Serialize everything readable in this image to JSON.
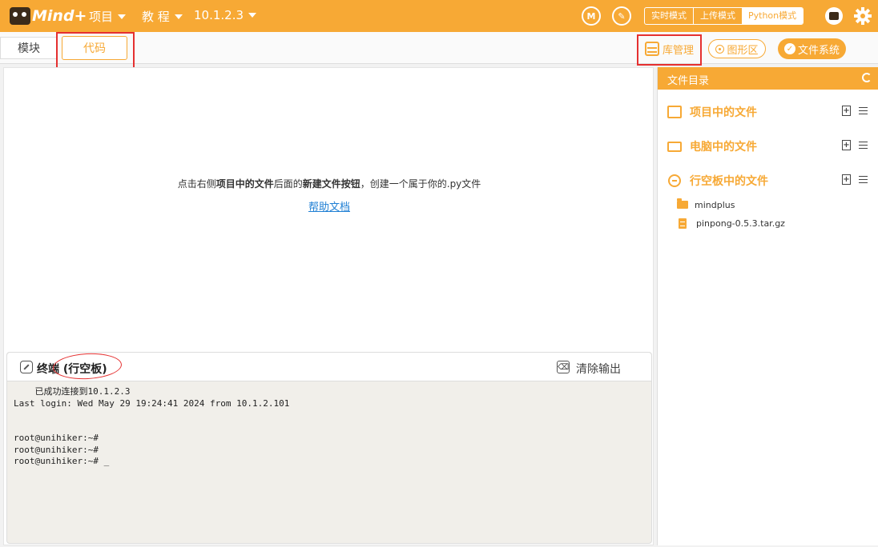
{
  "topbar": {
    "logo_text": "Mind+",
    "menu_project": "项目",
    "menu_tutorial": "教 程",
    "menu_device": "10.1.2.3",
    "modes": [
      "实时模式",
      "上传模式",
      "Python模式"
    ],
    "active_mode": "Python模式"
  },
  "subbar": {
    "tab_module": "模块",
    "tab_code": "代码",
    "lib_manage": "库管理",
    "graph_area": "图形区",
    "file_system": "文件系统"
  },
  "editor": {
    "hint_part1": "点击右侧",
    "hint_bold1": "项目中的文件",
    "hint_part2": "后面的",
    "hint_bold2": "新建文件按钮",
    "hint_part3": "，创建一个属于你的.py文件",
    "help_link": "帮助文档"
  },
  "terminal": {
    "title": "终端 (行空板)",
    "clear_label": "清除输出",
    "lines": [
      "    已成功连接到10.1.2.3",
      "Last login: Wed May 29 19:24:41 2024 from 10.1.2.101",
      "",
      "",
      "root@unihiker:~#",
      "root@unihiker:~#",
      "root@unihiker:~# _"
    ]
  },
  "files": {
    "header": "文件目录",
    "sections": {
      "project": "项目中的文件",
      "computer": "电脑中的文件",
      "board": "行空板中的文件"
    },
    "board_items": [
      {
        "name": "mindplus",
        "type": "folder"
      },
      {
        "name": "pinpong-0.5.3.tar.gz",
        "type": "file"
      }
    ]
  },
  "colors": {
    "accent": "#f7a935",
    "annotation": "#e53030",
    "link": "#1f7fd4"
  }
}
